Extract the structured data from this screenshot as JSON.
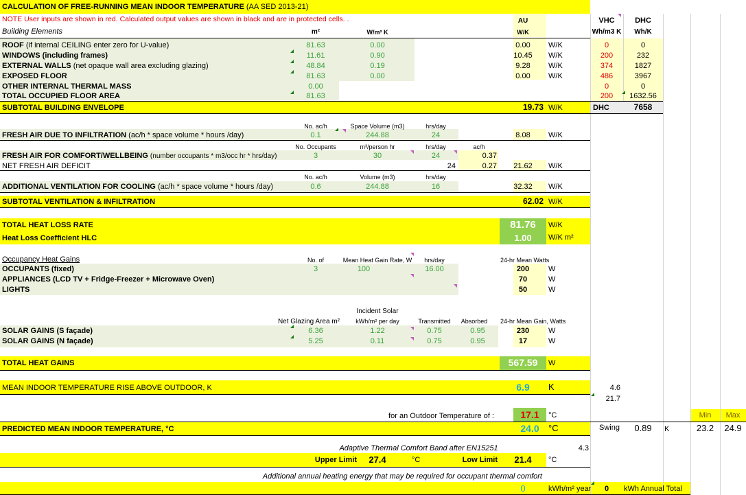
{
  "header": {
    "title": "CALCULATION OF FREE-RUNNING MEAN INDOOR TEMPERATURE",
    "title_ref": "(AA SED 2013-21)",
    "note": "NOTE User inputs are shown in red. Calculated output values are shown in black and are in protected cells. .",
    "building_elements": "Building Elements",
    "m2": "m²",
    "wm2k": "W/m² K",
    "au": "AU",
    "wk": "W/K",
    "vhc": "VHC",
    "vhc_unit": "Wh/m3 K",
    "dhc": "DHC",
    "dhc_unit": "Wh/K"
  },
  "elements": [
    {
      "label": "ROOF",
      "note": "(if internal CEILING enter zero for U-value)",
      "area": "81.63",
      "u": "0.00",
      "au": "0.00",
      "unit": "W/K",
      "vhc": "0",
      "dhc": "0"
    },
    {
      "label": "WINDOWS (including frames)",
      "note": "",
      "area": "11.61",
      "u": "0.90",
      "au": "10.45",
      "unit": "W/K",
      "vhc": "200",
      "dhc": "232"
    },
    {
      "label": "EXTERNAL WALLS",
      "note": "(net opaque wall area excluding glazing)",
      "area": "48.84",
      "u": "0.19",
      "au": "9.28",
      "unit": "W/K",
      "vhc": "374",
      "dhc": "1827"
    },
    {
      "label": "EXPOSED FLOOR",
      "note": "",
      "area": "81.63",
      "u": "0.00",
      "au": "0.00",
      "unit": "W/K",
      "vhc": "486",
      "dhc": "3967"
    },
    {
      "label": "OTHER INTERNAL THERMAL MASS",
      "note": "",
      "area": "0.00",
      "u": "",
      "au": "",
      "unit": "",
      "vhc": "0",
      "dhc": "0"
    },
    {
      "label": "TOTAL OCCUPIED FLOOR AREA",
      "note": "",
      "area": "81.63",
      "u": "",
      "au": "",
      "unit": "",
      "vhc": "200",
      "dhc": "1632.56"
    }
  ],
  "subtotal_envelope": {
    "label": "SUBTOTAL BUILDING ENVELOPE",
    "value": "19.73",
    "unit": "W/K",
    "dhc_label": "DHC",
    "dhc_value": "7658"
  },
  "infiltration": {
    "h1": "No. ac/h",
    "h2": "Space Volume (m3)",
    "h3": "hrs/day",
    "label": "FRESH AIR DUE TO INFILTRATION",
    "note": "(ac/h * space volume * hours /day)",
    "ach": "0.1",
    "vol": "244.88",
    "hrs": "24",
    "value": "8.08",
    "unit": "W/K"
  },
  "comfort": {
    "h1": "No. Occupants",
    "h2": "m³/person hr",
    "h3": "hrs/day",
    "h4": "ac/h",
    "label": "FRESH AIR FOR COMFORT/WELLBEING",
    "note": "(number occupants * m3/occ hr * hrs/day)",
    "occ": "3",
    "rate": "30",
    "hrs": "24",
    "ach": "0.37"
  },
  "deficit": {
    "label": "NET FRESH AIR DEFICIT",
    "hrs": "24",
    "ach": "0.27",
    "value": "21.62",
    "unit": "W/K"
  },
  "cooling": {
    "h1": "No. ac/h",
    "h2": "Volume (m3)",
    "h3": "hrs/day",
    "label": "ADDITIONAL VENTILATION FOR COOLING",
    "note": "(ac/h * space volume * hours /day)",
    "ach": "0.6",
    "vol": "244.88",
    "hrs": "16",
    "value": "32.32",
    "unit": "W/K"
  },
  "subtotal_vent": {
    "label": "SUBTOTAL VENTILATION & INFILTRATION",
    "value": "62.02",
    "unit": "W/K"
  },
  "heat_loss": {
    "label": "TOTAL HEAT LOSS RATE",
    "value": "81.76",
    "unit": "W/K"
  },
  "hlc": {
    "label": "Heat Loss Coefficient HLC",
    "value": "1.00",
    "unit": "W/K m²"
  },
  "occupancy": {
    "title": "Occupancy Heat Gains",
    "h1": "No. of",
    "h2": "Mean Heat Gain Rate, W",
    "h3": "hrs/day",
    "h4": "24-hr Mean Watts",
    "rows": [
      {
        "label": "OCCUPANTS (fixed)",
        "n": "3",
        "rate": "100",
        "hrs": "16.00",
        "watts": "200",
        "unit": "W"
      },
      {
        "label": "APPLIANCES (LCD TV + Fridge-Freezer + Microwave Oven)",
        "n": "",
        "rate": "",
        "hrs": "",
        "watts": "70",
        "unit": "W"
      },
      {
        "label": "LIGHTS",
        "n": "",
        "rate": "",
        "hrs": "",
        "watts": "50",
        "unit": "W"
      }
    ]
  },
  "solar": {
    "h_incident": "Incident Solar",
    "h1": "Net Glazing Area  m²",
    "h2": "kWh/m² per day",
    "h3": "Transmitted",
    "h4": "Absorbed",
    "h5": "24-hr Mean Gain, Watts",
    "rows": [
      {
        "label": "SOLAR GAINS (S façade)",
        "area": "6.36",
        "inc": "1.22",
        "trans": "0.75",
        "abs": "0.95",
        "gain": "230",
        "unit": "W"
      },
      {
        "label": "SOLAR GAINS (N façade)",
        "area": "5.25",
        "inc": "0.11",
        "trans": "0.75",
        "abs": "0.95",
        "gain": "17",
        "unit": "W"
      }
    ]
  },
  "total_gains": {
    "label": "TOTAL HEAT GAINS",
    "value": "567.59",
    "unit": "W"
  },
  "rise": {
    "label": "MEAN INDOOR TEMPERATURE RISE ABOVE OUTDOOR, K",
    "value": "6.9",
    "unit": "K",
    "side1": "4.6",
    "side2": "21.7"
  },
  "outdoor": {
    "label": "for an Outdoor Temperature of :",
    "value": "17.1",
    "unit": "°C",
    "min_label": "Min",
    "max_label": "Max"
  },
  "predicted": {
    "label": "PREDICTED MEAN INDOOR TEMPERATURE, °C",
    "value": "24.0",
    "unit": "°C",
    "swing_label": "Swing",
    "swing": "0.89",
    "swing_unit": "K",
    "min": "23.2",
    "max": "24.9"
  },
  "adaptive": {
    "title": "Adaptive Thermal Comfort Band after EN15251",
    "side": "4.3",
    "upper_label": "Upper Limit",
    "upper": "27.4",
    "unit": "°C",
    "lower_label": "Low Limit",
    "lower": "21.4",
    "lower_unit": "°C"
  },
  "heating": {
    "note": "Additional annual heating energy that may be required for occupant thermal comfort",
    "value": "0",
    "unit": "kWh/m² year",
    "total": "0",
    "total_label": "kWh Annual Total"
  }
}
